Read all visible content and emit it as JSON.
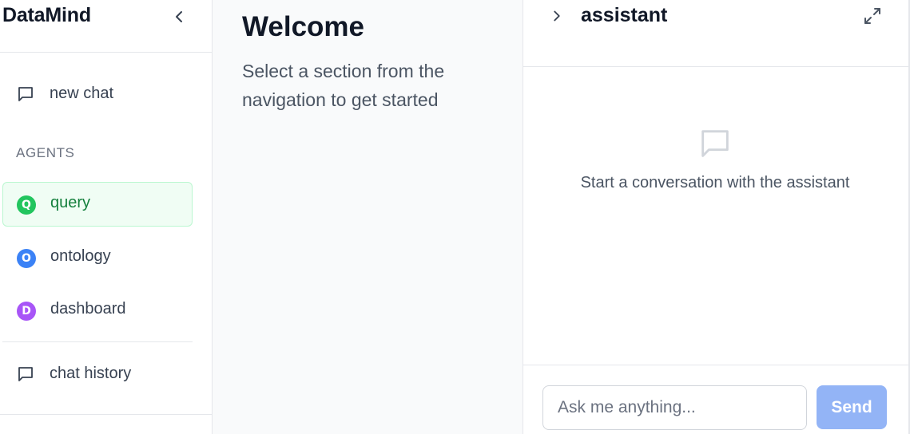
{
  "sidebar": {
    "brand": "DataMind",
    "new_chat_label": "new chat",
    "agents_heading": "AGENTS",
    "agents": [
      {
        "label": "query",
        "badge": "Q",
        "color": "#22c55e",
        "active": true
      },
      {
        "label": "ontology",
        "badge": "O",
        "color": "#3b82f6",
        "active": false
      },
      {
        "label": "dashboard",
        "badge": "D",
        "color": "#a855f7",
        "active": false
      }
    ],
    "chat_history_label": "chat history",
    "icons": {
      "collapse": "chevron-left-icon",
      "new_chat": "message-square-icon",
      "chat_history": "message-square-icon"
    }
  },
  "main": {
    "title": "Welcome",
    "subtitle": "Select a section from the navigation to get started"
  },
  "assistant": {
    "title": "assistant",
    "empty_text": "Start a conversation with the assistant",
    "input_placeholder": "Ask me anything...",
    "input_value": "",
    "send_label": "Send",
    "accent_color": "#93b4f6",
    "icons": {
      "toggle": "chevron-right-icon",
      "expand": "maximize-icon",
      "empty": "message-square-icon"
    }
  }
}
